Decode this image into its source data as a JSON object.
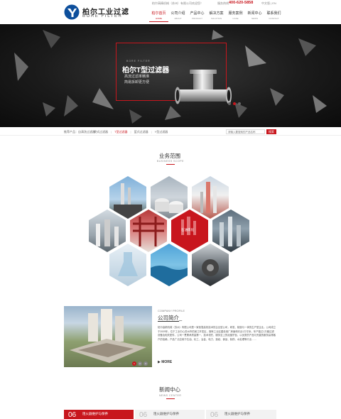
{
  "header": {
    "logo_cn": "柏尔工业过滤",
    "logo_en": "BORE FILTER",
    "topline": "柏尔高精机械（苏州）有限公司欢迎您！",
    "hotline_label": "服务热线：",
    "hotline": "400-620-5858",
    "langs": "中文版 | EN"
  },
  "nav": [
    {
      "cn": "柏尔首页",
      "en": "HOME",
      "active": true
    },
    {
      "cn": "公司介绍",
      "en": "ABOUT",
      "active": false
    },
    {
      "cn": "产品中心",
      "en": "PRODUCT",
      "active": false
    },
    {
      "cn": "解决方案",
      "en": "SOLUTION",
      "active": false
    },
    {
      "cn": "服务案例",
      "en": "CASE",
      "active": false
    },
    {
      "cn": "新闻中心",
      "en": "NEWS",
      "active": false
    },
    {
      "cn": "联系我们",
      "en": "CONTACT",
      "active": false
    }
  ],
  "hero": {
    "kicker": "BORE FILTER",
    "title": "柏尔T型过滤器",
    "sub1": "高流过滤率精准",
    "sub2": "简易拆卸更方便"
  },
  "hotbar": {
    "label": "推荐产品：自清洗过滤器",
    "links": [
      {
        "text": "袋式过滤器",
        "active": false
      },
      {
        "text": "T型过滤器",
        "active": true
      },
      {
        "text": "篮式过滤器",
        "active": false
      },
      {
        "text": "Y型过滤器",
        "active": false
      }
    ],
    "search_placeholder": "请输入要搜索的产品名称",
    "search_button": "搜索"
  },
  "business": {
    "title_cn": "业务范围",
    "title_en": "BUSINESS SCOPE",
    "hex_label": "石油炼化"
  },
  "company": {
    "title_en": "COMPANY PROFILE",
    "title_cn": "公司简介_",
    "text": "柏尔高精机械（苏州）有限公司是一家依靠高效技术的企业型公司，研发、制造与一体的生产型企业。公司成立于2009年，位于工业中心苏州市的吴江开发区，拥有工业区建设用厂房面积约近1万平米，年产能达1万套过滤设备及相关配件，公司一贯秉承质量第一、技术领先、服务至上的经营宗旨，以优质的产品与完善的服务赢得客户的信赖，产品广泛应用于石油、化工、冶金、电力、造纸、食品、制药、水处理等行业……",
    "more": "MORE",
    "dots": [
      "1",
      "2",
      "3"
    ]
  },
  "news": {
    "title_cn": "新闻中心",
    "title_en": "NEWS CENTER",
    "cards": [
      {
        "date": "06",
        "title": "阻火器维护与保养"
      },
      {
        "date": "06",
        "title": "阻火器维护与保养"
      },
      {
        "date": "06",
        "title": "阻火器维护与保养"
      }
    ]
  },
  "colors": {
    "accent": "#c8161d",
    "hero_bg": "#151515"
  },
  "icons": [
    "logo-mark-icon",
    "more-arrow-icon"
  ]
}
